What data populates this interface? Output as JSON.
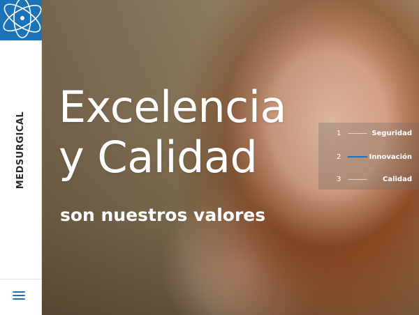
{
  "brand": {
    "name": "MEDSURGICAL",
    "logo_icon": "atom-icon",
    "accent": "#1b73b9"
  },
  "menu": {
    "icon": "hamburger-menu-icon"
  },
  "hero": {
    "headline_line1": "Excelencia",
    "headline_line2": "y Calidad",
    "subline": "son nuestros valores"
  },
  "values": [
    {
      "number": "1",
      "label": "Seguridad",
      "active": false
    },
    {
      "number": "2",
      "label": "Innovación",
      "active": true
    },
    {
      "number": "3",
      "label": "Calidad",
      "active": false
    }
  ]
}
